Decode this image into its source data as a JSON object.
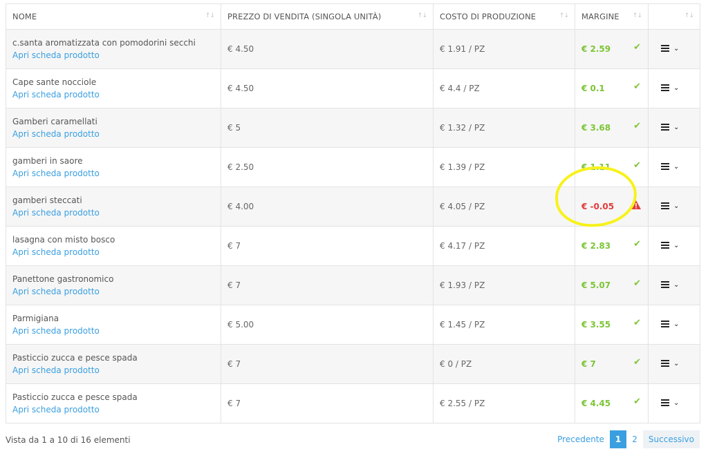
{
  "columns": {
    "nome": "NOME",
    "prezzo": "PREZZO DI VENDITA (SINGOLA UNITÀ)",
    "costo": "COSTO DI PRODUZIONE",
    "margine": "MARGINE"
  },
  "sort_icon": "↑↓",
  "link_label": "Apri scheda prodotto",
  "rows": [
    {
      "name": "c.santa aromatizzata con pomodorini secchi",
      "price": "€ 4.50",
      "cost": "€ 1.91 / PZ",
      "margin": "€ 2.59",
      "status": "ok"
    },
    {
      "name": "Cape sante nocciole",
      "price": "€ 4.50",
      "cost": "€ 4.4 / PZ",
      "margin": "€ 0.1",
      "status": "ok"
    },
    {
      "name": "Gamberi caramellati",
      "price": "€ 5",
      "cost": "€ 1.32 / PZ",
      "margin": "€ 3.68",
      "status": "ok"
    },
    {
      "name": "gamberi in saore",
      "price": "€ 2.50",
      "cost": "€ 1.39 / PZ",
      "margin": "€ 1.11",
      "status": "ok"
    },
    {
      "name": "gamberi steccati",
      "price": "€ 4.00",
      "cost": "€ 4.05 / PZ",
      "margin": "€ -0.05",
      "status": "warning"
    },
    {
      "name": "lasagna con misto bosco",
      "price": "€ 7",
      "cost": "€ 4.17 / PZ",
      "margin": "€ 2.83",
      "status": "ok"
    },
    {
      "name": "Panettone gastronomico",
      "price": "€ 7",
      "cost": "€ 1.93 / PZ",
      "margin": "€ 5.07",
      "status": "ok"
    },
    {
      "name": "Parmigiana",
      "price": "€ 5.00",
      "cost": "€ 1.45 / PZ",
      "margin": "€ 3.55",
      "status": "ok"
    },
    {
      "name": "Pasticcio zucca e pesce spada",
      "price": "€ 7",
      "cost": "€ 0 / PZ",
      "margin": "€ 7",
      "status": "ok"
    },
    {
      "name": "Pasticcio zucca e pesce spada",
      "price": "€ 7",
      "cost": "€ 2.55 / PZ",
      "margin": "€ 4.45",
      "status": "ok"
    }
  ],
  "icons": {
    "ok": "check-icon",
    "warning": "warning-triangle-icon",
    "menu": "hamburger-menu-icon",
    "caret": "chevron-down-icon"
  },
  "colors": {
    "link": "#3a9fe0",
    "ok": "#7dc536",
    "bad": "#e33b3b",
    "highlight": "#f7f21a"
  },
  "footer": {
    "info": "Vista da 1 a 10 di 16 elementi",
    "prev": "Precedente",
    "pages": [
      "1",
      "2"
    ],
    "active_page": "1",
    "next": "Successivo"
  }
}
